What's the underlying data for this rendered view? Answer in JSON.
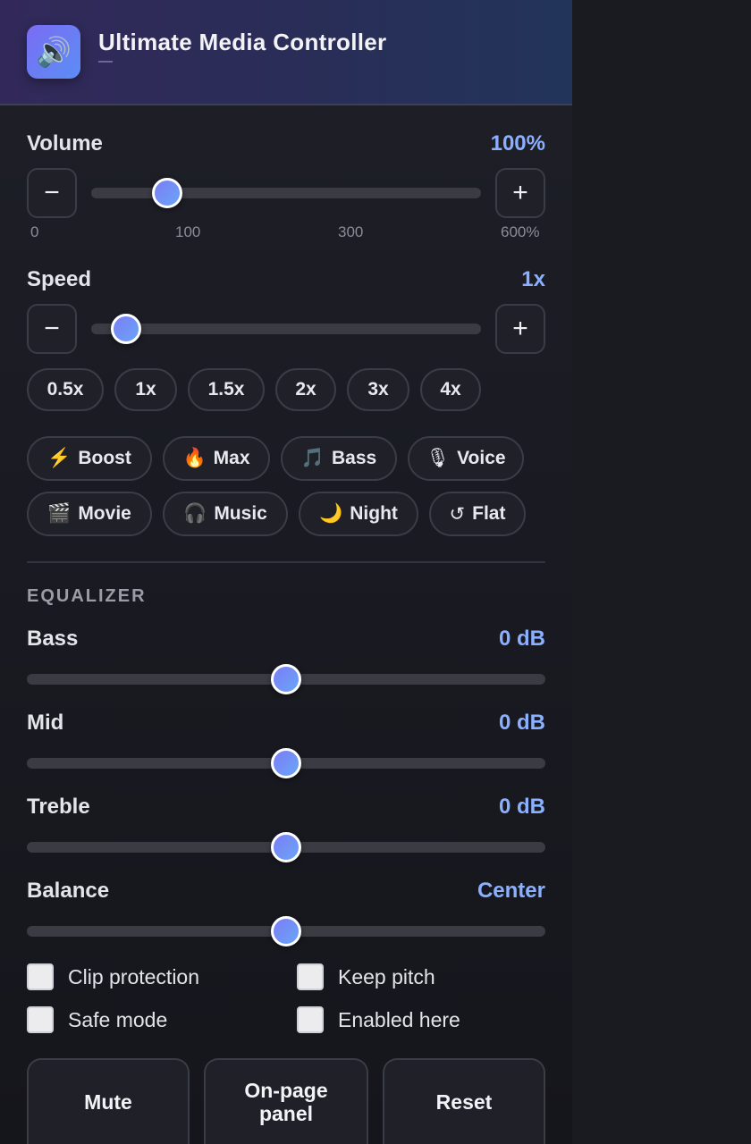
{
  "header": {
    "title": "Ultimate Media Controller",
    "subtitle": "—",
    "icon": "speaker-icon"
  },
  "volume": {
    "label": "Volume",
    "value_text": "100%",
    "value": 100,
    "min": 0,
    "max": 600,
    "ticks": [
      "0",
      "100",
      "300",
      "600%"
    ],
    "minus": "−",
    "plus": "+"
  },
  "speed": {
    "label": "Speed",
    "value_text": "1x",
    "value": 1,
    "minus": "−",
    "plus": "+",
    "presets": [
      "0.5x",
      "1x",
      "1.5x",
      "2x",
      "3x",
      "4x"
    ]
  },
  "modes": [
    {
      "icon": "⚡",
      "label": "Boost",
      "icon_name": "lightning-icon"
    },
    {
      "icon": "🔥",
      "label": "Max",
      "icon_name": "fire-icon"
    },
    {
      "icon": "🎵",
      "label": "Bass",
      "icon_name": "music-note-icon"
    },
    {
      "icon": "🎙",
      "label": "Voice",
      "icon_name": "microphone-icon"
    },
    {
      "icon": "🎬",
      "label": "Movie",
      "icon_name": "clapperboard-icon"
    },
    {
      "icon": "🎧",
      "label": "Music",
      "icon_name": "headphones-icon"
    },
    {
      "icon": "🌙",
      "label": "Night",
      "icon_name": "moon-icon"
    },
    {
      "icon": "↺",
      "label": "Flat",
      "icon_name": "reset-icon"
    }
  ],
  "equalizer": {
    "title": "EQUALIZER",
    "bands": [
      {
        "label": "Bass",
        "value_text": "0 dB",
        "level": 0.5
      },
      {
        "label": "Mid",
        "value_text": "0 dB",
        "level": 0.5
      },
      {
        "label": "Treble",
        "value_text": "0 dB",
        "level": 0.5
      },
      {
        "label": "Balance",
        "value_text": "Center",
        "level": 0.5
      }
    ]
  },
  "options": {
    "clip_protection": "Clip protection",
    "keep_pitch": "Keep pitch",
    "safe_mode": "Safe mode",
    "enabled_here": "Enabled here"
  },
  "actions": {
    "mute": "Mute",
    "panel": "On-page panel",
    "reset": "Reset"
  },
  "colors": {
    "accent": "#8ab0ff",
    "background": "#17181e"
  }
}
